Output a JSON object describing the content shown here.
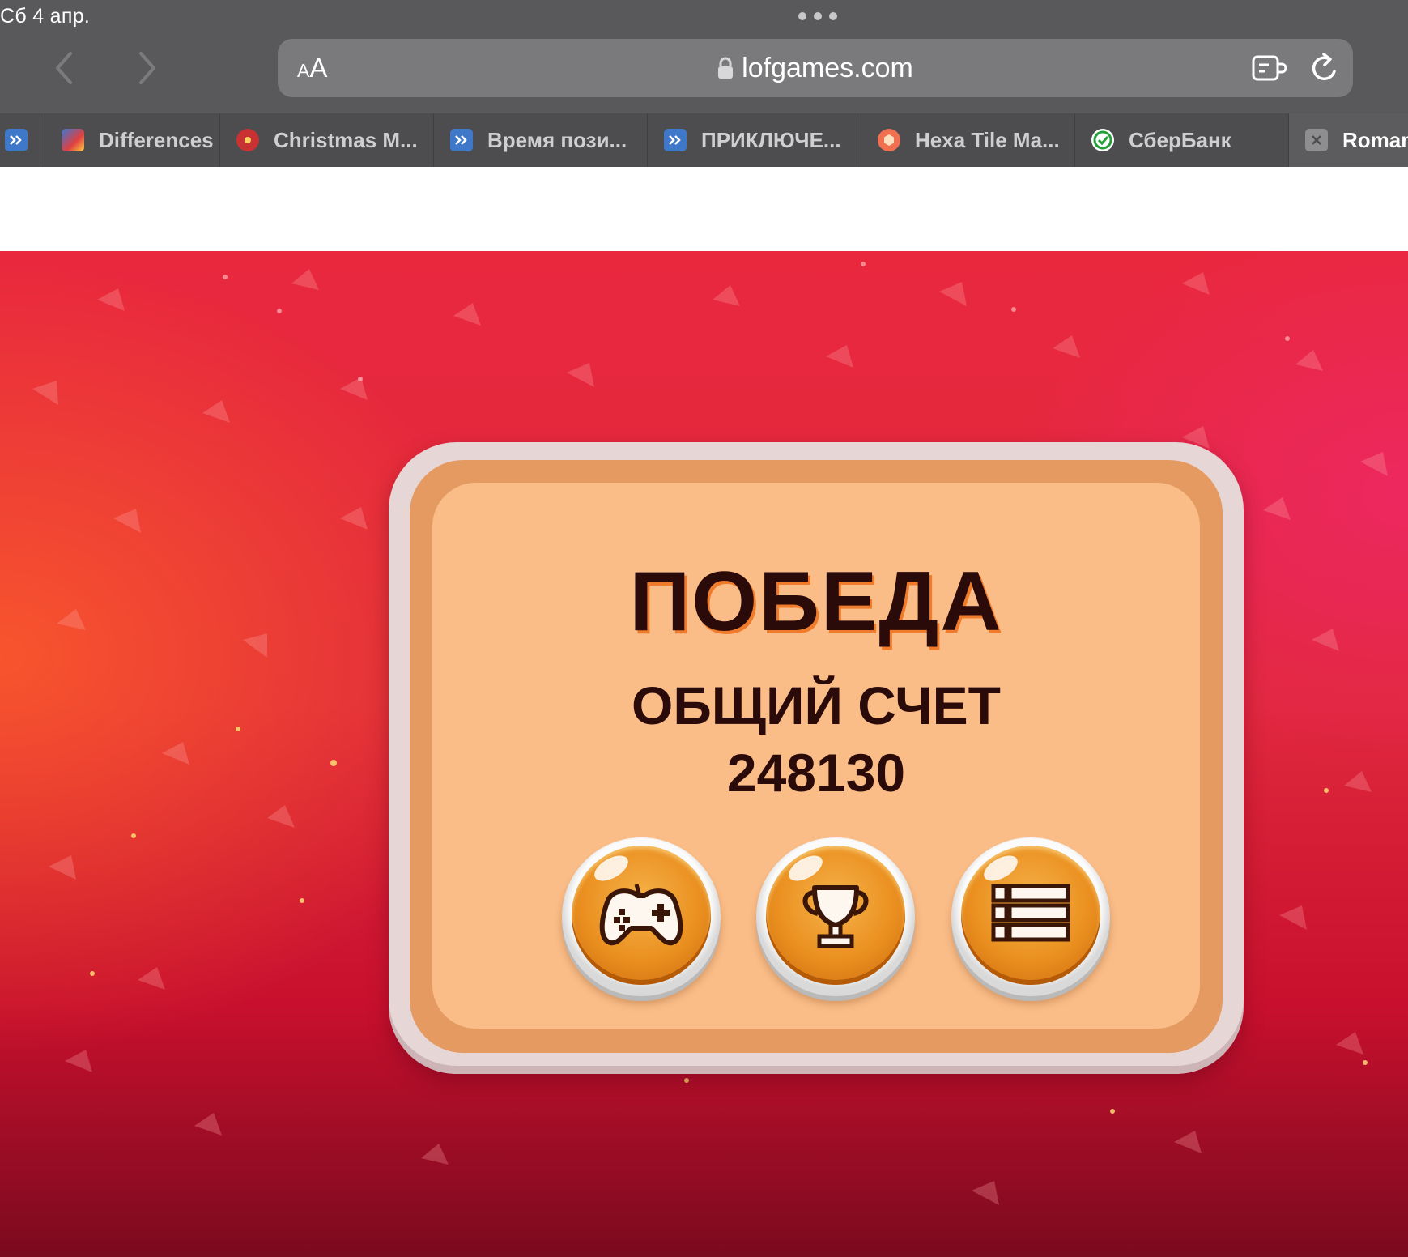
{
  "status_bar": {
    "time": "Сб 4 апр."
  },
  "browser": {
    "aa_small": "A",
    "aa_large": "A",
    "url": "lofgames.com",
    "tabs": [
      {
        "label": "",
        "icon": "blue-arrows-icon"
      },
      {
        "label": "Differences",
        "icon": "differences-game-icon"
      },
      {
        "label": "Christmas M...",
        "icon": "christmas-icon"
      },
      {
        "label": "Время пози...",
        "icon": "blue-arrows-icon"
      },
      {
        "label": "ПРИКЛЮЧЕ...",
        "icon": "blue-arrows-icon"
      },
      {
        "label": "Hexa Tile Ma...",
        "icon": "hexa-icon"
      },
      {
        "label": "СберБанк",
        "icon": "sber-icon"
      },
      {
        "label": "Roman",
        "icon": "close-icon",
        "active": true
      }
    ]
  },
  "game": {
    "title": "ПОБЕДА",
    "score_label": "ОБЩИЙ СЧЕТ",
    "score_value": "248130",
    "buttons": [
      {
        "name": "play",
        "icon": "gamepad-icon"
      },
      {
        "name": "achievements",
        "icon": "trophy-icon"
      },
      {
        "name": "menu",
        "icon": "list-icon"
      }
    ],
    "colors": {
      "title": "#2b0a0a",
      "title_shadow": "#f07b2a",
      "card": "#fbbd87",
      "button": "#ea8f1f",
      "background": "#e0283c"
    }
  }
}
